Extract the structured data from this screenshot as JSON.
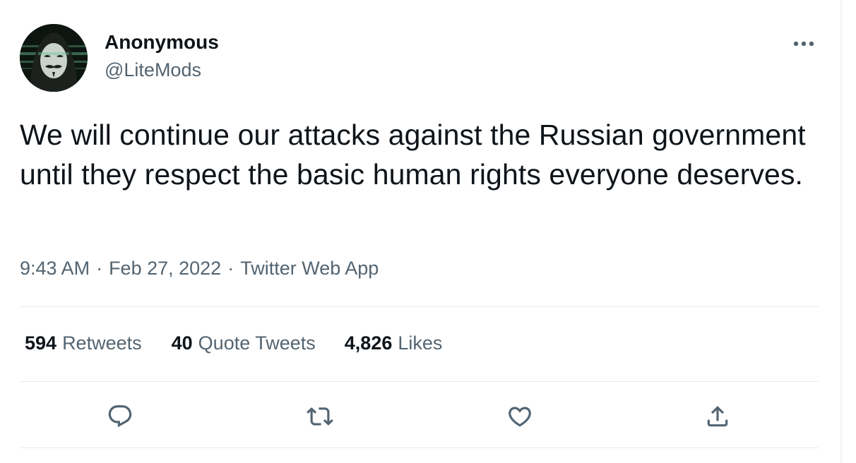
{
  "author": {
    "name": "Anonymous",
    "handle": "@LiteMods",
    "avatar_icon": "anonymous-mask-avatar"
  },
  "tweet": {
    "text": "We will continue our attacks against the Russian government until they respect the basic human rights everyone deserves.",
    "time": "9:43 AM",
    "separator": "·",
    "date": "Feb 27, 2022",
    "source": "Twitter Web App"
  },
  "stats": {
    "retweets": {
      "count": "594",
      "label": "Retweets"
    },
    "quotes": {
      "count": "40",
      "label": "Quote Tweets"
    },
    "likes": {
      "count": "4,826",
      "label": "Likes"
    }
  },
  "actions": [
    "reply-icon",
    "retweet-icon",
    "like-icon",
    "share-icon"
  ],
  "colors": {
    "text_primary": "#0f1419",
    "text_secondary": "#536471",
    "divider": "#e6ecf0"
  }
}
